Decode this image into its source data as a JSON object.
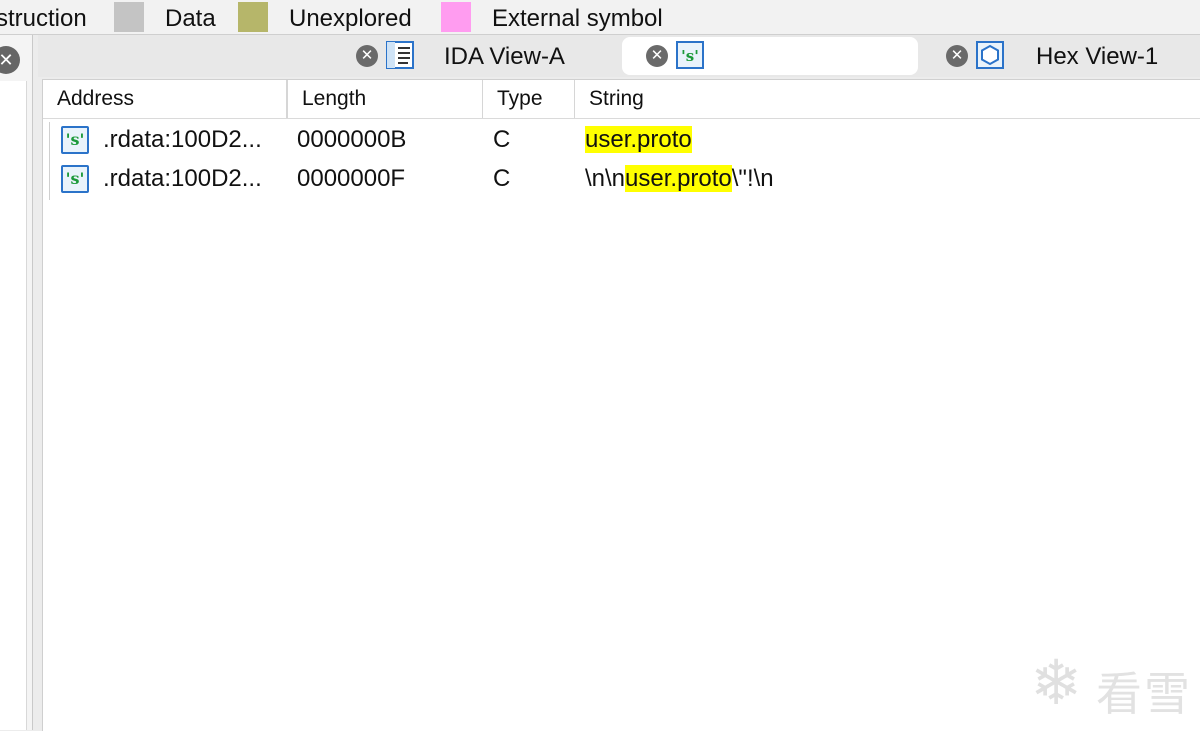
{
  "legend": {
    "items": [
      {
        "label": "struction",
        "color": "#c4c4c4"
      },
      {
        "label": "Data",
        "color": "#b6b66a"
      },
      {
        "label": "Unexplored",
        "color": "#ff9cf0"
      },
      {
        "label": "External symbol",
        "color": null
      }
    ]
  },
  "tabs": [
    {
      "label": "IDA View-A",
      "icon": "ida-view-icon",
      "active": false
    },
    {
      "label": "",
      "icon": "strings-icon",
      "active": true
    },
    {
      "label": "Hex View-1",
      "icon": "hex-view-icon",
      "active": false
    }
  ],
  "table": {
    "columns": [
      "Address",
      "Length",
      "Type",
      "String"
    ],
    "rows": [
      {
        "icon": "string-s-icon",
        "address": ".rdata:100D2...",
        "length": "0000000B",
        "type": "C",
        "string_pre": "",
        "string_match": "user.proto",
        "string_post": ""
      },
      {
        "icon": "string-s-icon",
        "address": ".rdata:100D2...",
        "length": "0000000F",
        "type": "C",
        "string_pre": "\\n\\n",
        "string_match": "user.proto",
        "string_post": "\\\"!\\n"
      }
    ]
  },
  "highlight_color": "#ffff00",
  "icon_glyph": "'s'",
  "watermark": "看雪"
}
